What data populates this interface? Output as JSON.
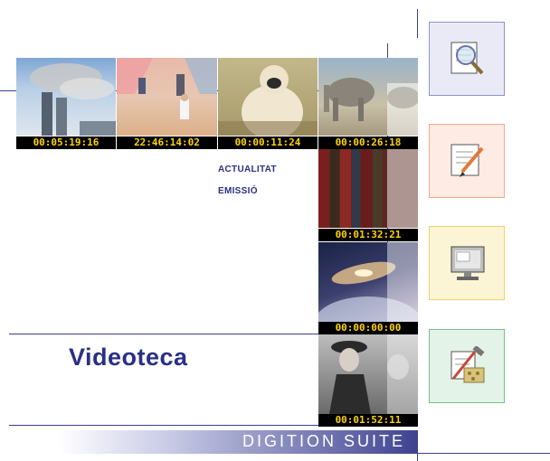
{
  "menu": {
    "items": [
      {
        "label": "ACTUALITAT"
      },
      {
        "label": "EMISSIÓ"
      }
    ]
  },
  "title": "Videoteca",
  "banner": "DIGITION SUITE",
  "clips": [
    {
      "timecode": "00:05:19:16",
      "scene": "smoking-towers"
    },
    {
      "timecode": "22:46:14:02",
      "scene": "street-figures"
    },
    {
      "timecode": "00:00:11:24",
      "scene": "gorilla"
    },
    {
      "timecode": "00:00:26:18",
      "scene": "elephants"
    },
    {
      "timecode": "00:01:32:21",
      "scene": "books"
    },
    {
      "timecode": "00:00:00:00",
      "scene": "galaxy"
    },
    {
      "timecode": "00:01:52:11",
      "scene": "film-noir"
    }
  ],
  "tools": [
    {
      "icon": "magnifier-document-icon",
      "color": "#8f92c9"
    },
    {
      "icon": "document-pencil-icon",
      "color": "#f4a98a"
    },
    {
      "icon": "computer-monitor-icon",
      "color": "#e9d36a"
    },
    {
      "icon": "hammer-tools-icon",
      "color": "#76c08a"
    }
  ]
}
